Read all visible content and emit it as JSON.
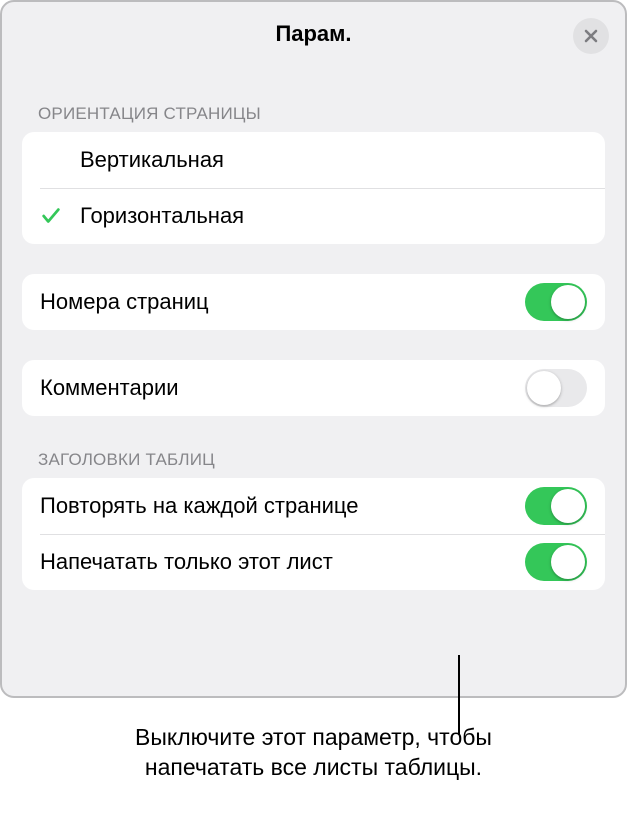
{
  "header": {
    "title": "Парам."
  },
  "sections": {
    "orientation": {
      "header": "ОРИЕНТАЦИЯ СТРАНИЦЫ",
      "options": {
        "portrait": "Вертикальная",
        "landscape": "Горизонтальная"
      },
      "selected": "landscape"
    },
    "pageNumbers": {
      "label": "Номера страниц",
      "value": true
    },
    "comments": {
      "label": "Комментарии",
      "value": false
    },
    "tableHeaders": {
      "header": "ЗАГОЛОВКИ ТАБЛИЦ",
      "repeatEachPage": {
        "label": "Повторять на каждой странице",
        "value": true
      },
      "printOnlyThisSheet": {
        "label": "Напечатать только этот лист",
        "value": true
      }
    }
  },
  "callout": {
    "line1": "Выключите этот параметр, чтобы",
    "line2": "напечатать все листы таблицы."
  },
  "colors": {
    "accent": "#34c759"
  }
}
